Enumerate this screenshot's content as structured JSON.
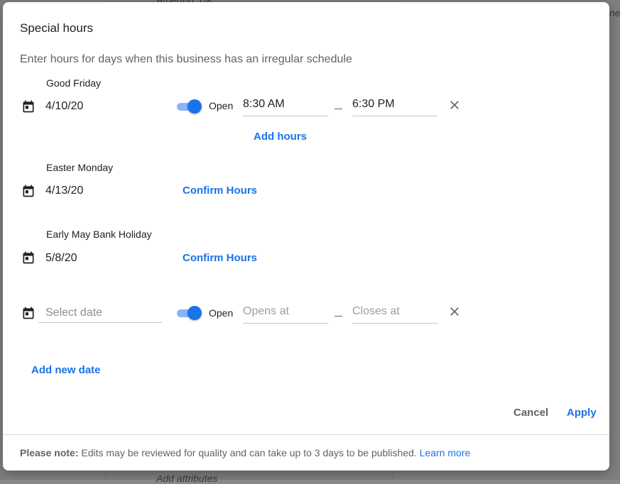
{
  "background": {
    "top_text": "Atherton, UK",
    "right_text": "ne",
    "bottom_text": "Add attributes"
  },
  "dialog": {
    "title": "Special hours",
    "subtitle": "Enter hours for days when this business has an irregular schedule"
  },
  "entries": [
    {
      "label": "Good Friday",
      "date": "4/10/20",
      "open_label": "Open",
      "opens": "8:30 AM",
      "closes": "6:30 PM",
      "add_hours": "Add hours"
    },
    {
      "label": "Easter Monday",
      "date": "4/13/20",
      "confirm": "Confirm Hours"
    },
    {
      "label": "Early May Bank Holiday",
      "date": "5/8/20",
      "confirm": "Confirm Hours"
    }
  ],
  "new_entry": {
    "date_placeholder": "Select date",
    "open_label": "Open",
    "opens_placeholder": "Opens at",
    "closes_placeholder": "Closes at"
  },
  "add_new_date": "Add new date",
  "actions": {
    "cancel": "Cancel",
    "apply": "Apply"
  },
  "note": {
    "bold": "Please note:",
    "text": " Edits may be reviewed for quality and can take up to 3 days to be published.",
    "link": "Learn more"
  },
  "colors": {
    "accent": "#1a73e8",
    "toggle_track": "#8ab4f8"
  },
  "icons": {
    "calendar": "calendar-icon",
    "close": "close-icon"
  }
}
